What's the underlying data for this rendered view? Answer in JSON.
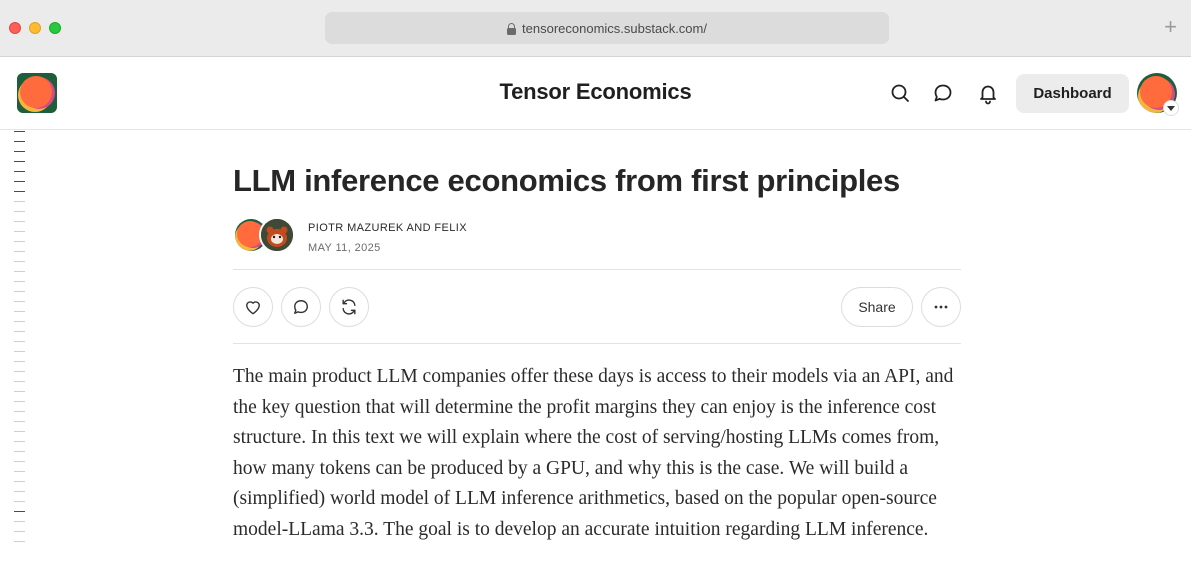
{
  "browser": {
    "url": "tensoreconomics.substack.com/"
  },
  "header": {
    "site_title": "Tensor Economics",
    "dashboard_label": "Dashboard",
    "icons": [
      "search-icon",
      "chat-icon",
      "bell-icon"
    ]
  },
  "article": {
    "title": "LLM inference economics from first principles",
    "authors": "PIOTR MAZUREK AND FELIX",
    "date": "MAY 11, 2025",
    "share_label": "Share",
    "body": "The main product LLM companies offer these days is access to their models via an API, and the key question that will determine the profit margins they can enjoy is the inference cost structure. In this text we will explain where the cost of serving/hosting LLMs comes from, how many tokens can be produced by a GPU, and why this is the case. We will build a (simplified) world model of LLM inference arithmetics, based on the popular open-source model-LLama 3.3. The goal is to develop an accurate intuition regarding LLM inference."
  },
  "colors": {
    "brand_orange": "#ff6b3d",
    "brand_green": "#1f5e3a",
    "brand_yellow": "#f4b63e"
  }
}
